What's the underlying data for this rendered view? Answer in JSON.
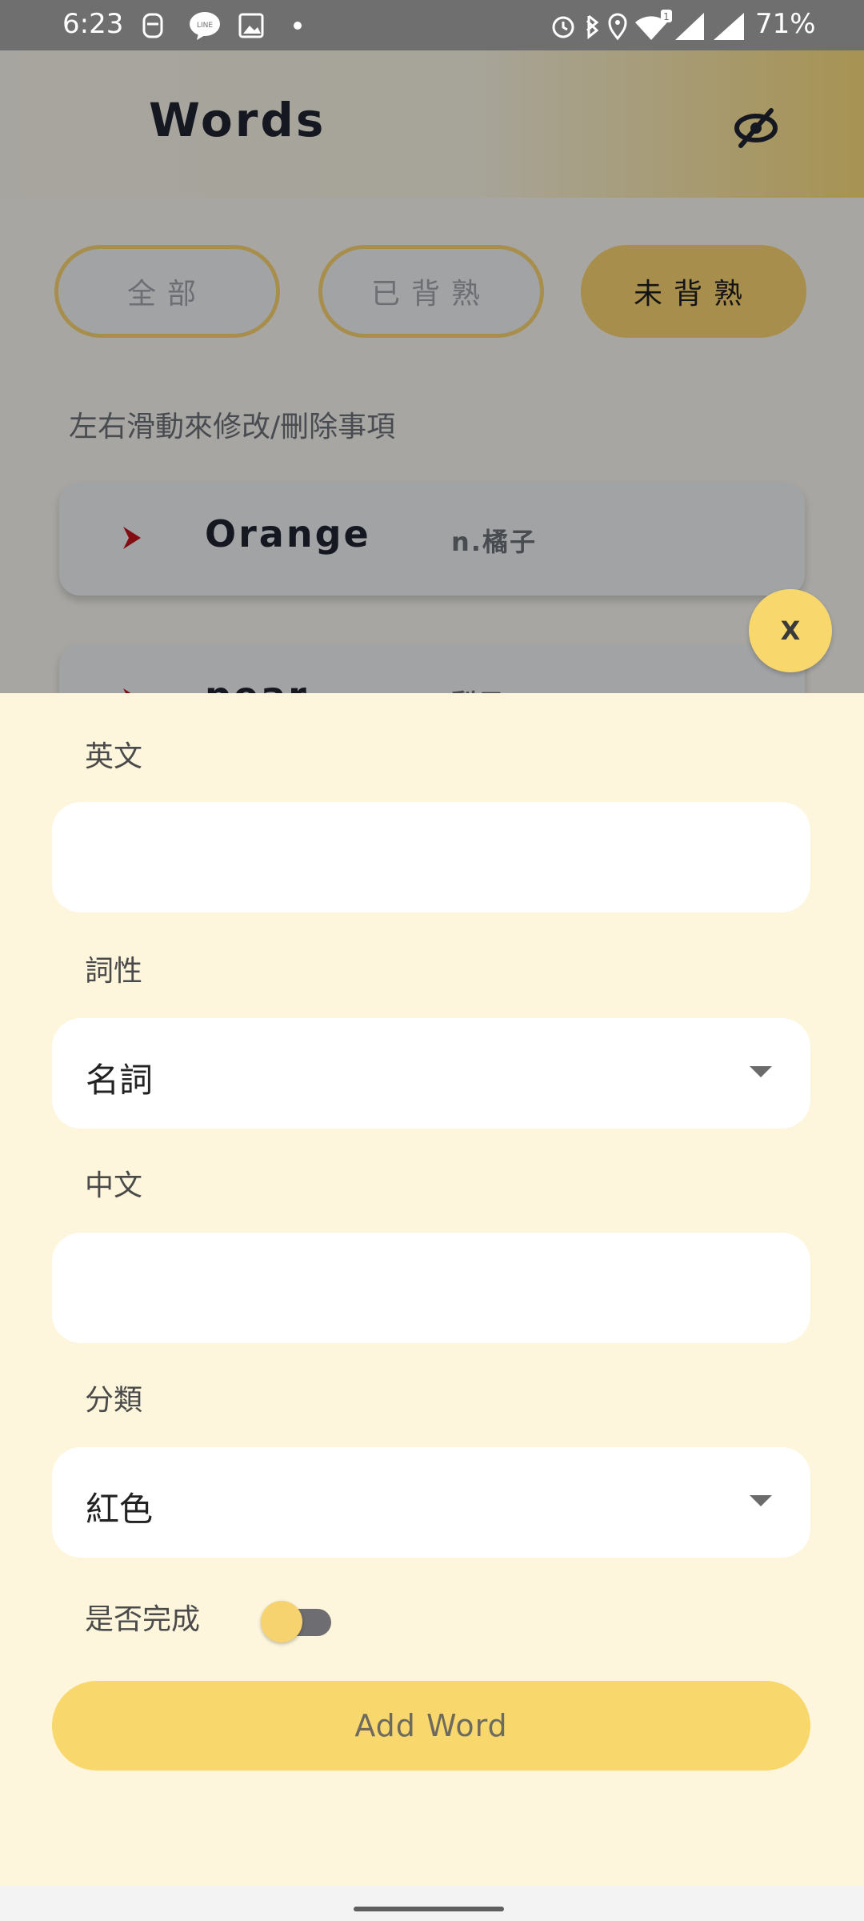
{
  "status_bar": {
    "time": "6:23",
    "battery": "71%",
    "left_icons": [
      "face-mask-icon",
      "line-app-icon",
      "gallery-icon",
      "dot-icon"
    ],
    "right_icons": [
      "alarm-icon",
      "bluetooth-icon",
      "location-icon",
      "wifi-icon",
      "signal-1-icon",
      "signal-2-icon"
    ]
  },
  "app": {
    "title": "Words",
    "visibility_icon": "eye-off-icon",
    "filters": [
      {
        "label": "全部",
        "active": false
      },
      {
        "label": "已背熟",
        "active": false
      },
      {
        "label": "未背熟",
        "active": true
      }
    ],
    "hint": "左右滑動來修改/刪除事項",
    "words": [
      {
        "en": "Orange",
        "zh": "n.橘子"
      },
      {
        "en": "pear",
        "zh": "梨子"
      }
    ],
    "close_label": "X"
  },
  "form": {
    "english_label": "英文",
    "english_value": "",
    "pos_label": "詞性",
    "pos_value": "名詞",
    "chinese_label": "中文",
    "chinese_value": "",
    "category_label": "分類",
    "category_value": "紅色",
    "done_label": "是否完成",
    "done_on": false,
    "submit_label": "Add Word"
  },
  "colors": {
    "accent": "#F8D86C",
    "sheet_bg": "#FDF5DC",
    "chevron": "#C0141C"
  }
}
